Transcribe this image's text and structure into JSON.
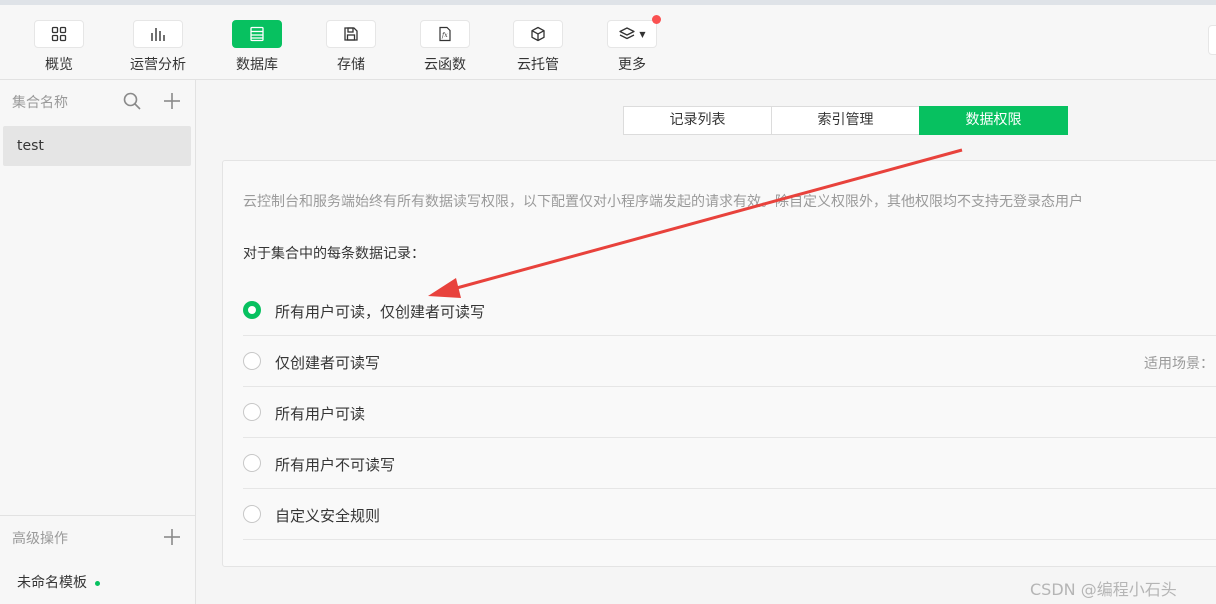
{
  "toolbar": {
    "items": [
      {
        "label": "概览",
        "icon": "grid-icon"
      },
      {
        "label": "运营分析",
        "icon": "bar-chart-icon"
      },
      {
        "label": "数据库",
        "icon": "database-icon"
      },
      {
        "label": "存储",
        "icon": "save-icon"
      },
      {
        "label": "云函数",
        "icon": "function-icon"
      },
      {
        "label": "云托管",
        "icon": "cube-icon"
      },
      {
        "label": "更多",
        "icon": "layers-icon"
      }
    ],
    "active_index": 2,
    "accent_color": "#07c160",
    "badge_color": "#fa5151"
  },
  "sidebar": {
    "collections_title": "集合名称",
    "collections": [
      {
        "name": "test"
      }
    ],
    "advanced_title": "高级操作",
    "template_name": "未命名模板"
  },
  "tabs": [
    {
      "label": "记录列表"
    },
    {
      "label": "索引管理"
    },
    {
      "label": "数据权限"
    }
  ],
  "permissions": {
    "notice": "云控制台和服务端始终有所有数据读写权限，以下配置仅对小程序端发起的请求有效。除自定义权限外，其他权限均不支持无登录态用户",
    "prompt": "对于集合中的每条数据记录：",
    "options": [
      {
        "label": "所有用户可读，仅创建者可读写",
        "selected": true,
        "side": ""
      },
      {
        "label": "仅创建者可读写",
        "selected": false,
        "side": "适用场景："
      },
      {
        "label": "所有用户可读",
        "selected": false,
        "side": ""
      },
      {
        "label": "所有用户不可读写",
        "selected": false,
        "side": ""
      },
      {
        "label": "自定义安全规则",
        "selected": false,
        "side": ""
      }
    ]
  },
  "annotation_color": "#e8423c",
  "watermark": "CSDN @编程小石头"
}
